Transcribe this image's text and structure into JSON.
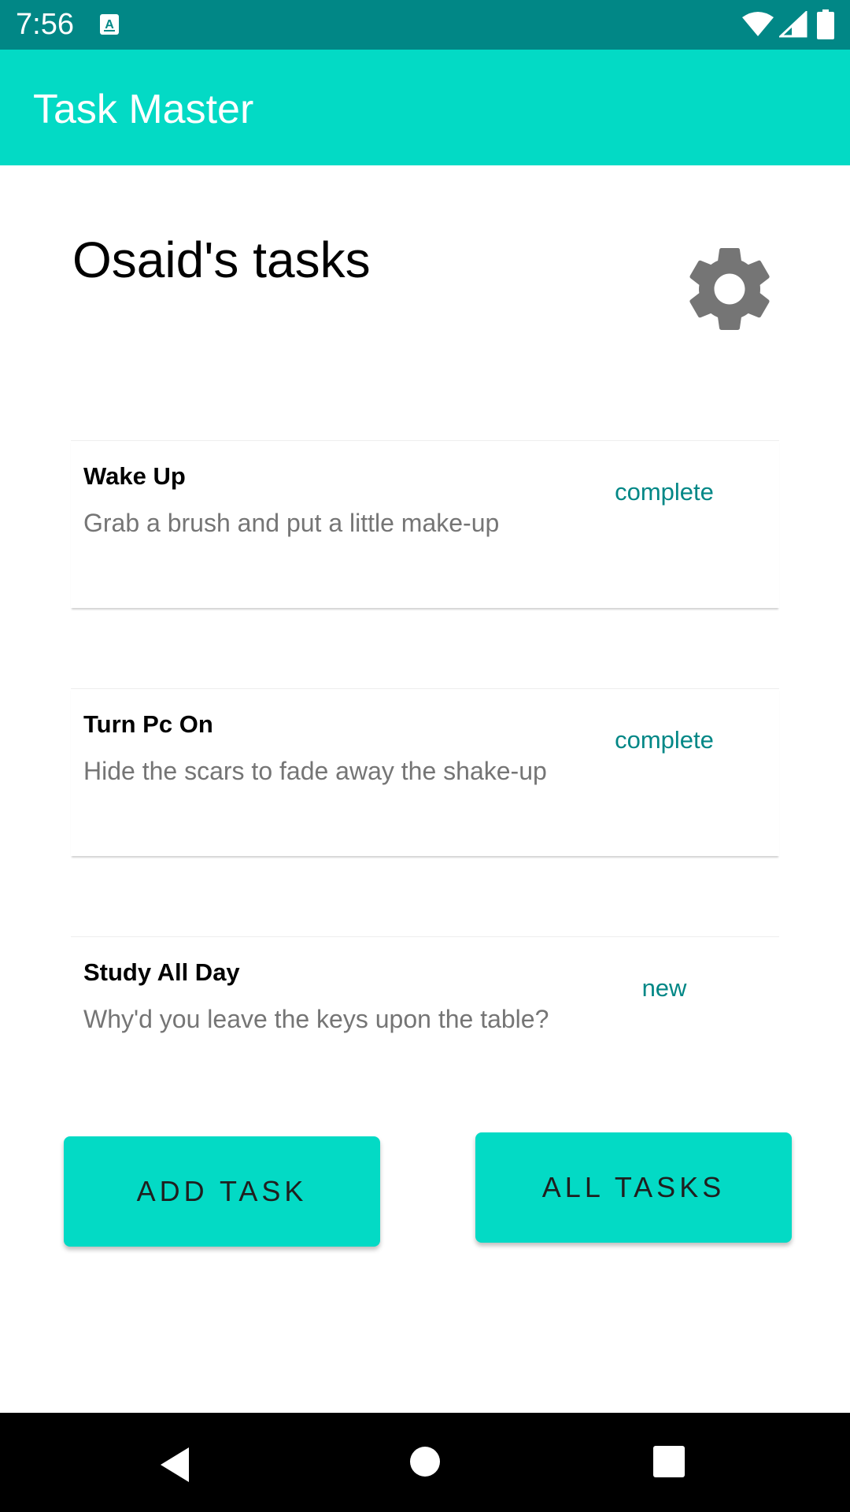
{
  "status_bar": {
    "time": "7:56",
    "icons": [
      "a-notification-icon",
      "wifi-icon",
      "signal-icon",
      "battery-icon"
    ]
  },
  "app_bar": {
    "title": "Task Master"
  },
  "header": {
    "title": "Osaid's tasks",
    "settings_icon": "gear-icon"
  },
  "tasks": [
    {
      "title": "Wake Up",
      "body": "Grab a brush and put a little make-up",
      "state": "complete"
    },
    {
      "title": "Turn Pc On",
      "body": "Hide the scars to fade away the shake-up",
      "state": "complete"
    },
    {
      "title": "Study All Day",
      "body": "Why'd you leave the keys upon the table?",
      "state": "new"
    }
  ],
  "buttons": {
    "add_task": "ADD TASK",
    "all_tasks": "ALL TASKS"
  },
  "colors": {
    "status_bar": "#018786",
    "app_bar": "#03dac5",
    "accent_text": "#018786",
    "gear": "#757575"
  },
  "nav_bar": {
    "icons": [
      "back-icon",
      "home-icon",
      "recents-icon"
    ]
  }
}
